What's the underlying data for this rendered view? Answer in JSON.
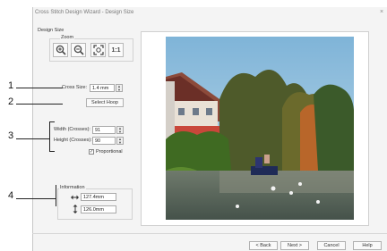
{
  "window": {
    "title": "Cross Stitch Design Wizard - Design Size",
    "close_glyph": "×"
  },
  "design_size": {
    "group_label": "Design Size",
    "zoom": {
      "label": "Zoom",
      "buttons": [
        {
          "name": "zoom-in",
          "icon": "zoom-in-icon"
        },
        {
          "name": "zoom-out",
          "icon": "zoom-out-icon"
        },
        {
          "name": "zoom-fit",
          "icon": "zoom-fit-icon"
        },
        {
          "name": "zoom-actual",
          "icon": "actual-size-icon",
          "text": "1:1"
        }
      ]
    },
    "cross_size": {
      "label": "Cross Size:",
      "value": "1.4 mm"
    },
    "select_hoop_label": "Select Hoop",
    "width": {
      "label": "Width (Crosses):",
      "value": "91"
    },
    "height": {
      "label": "Height (Crosses):",
      "value": "90"
    },
    "proportional": {
      "label": "Proportional",
      "checked": true,
      "check_glyph": "✓"
    },
    "information": {
      "label": "Information",
      "width_value": "127.4mm",
      "height_value": "126.0mm",
      "width_icon": "horizontal-arrows-icon",
      "height_icon": "vertical-arrows-icon"
    }
  },
  "callouts": [
    "1",
    "2",
    "3",
    "4"
  ],
  "footer": {
    "back": "< Back",
    "next": "Next >",
    "cancel": "Cancel",
    "help": "Help"
  }
}
